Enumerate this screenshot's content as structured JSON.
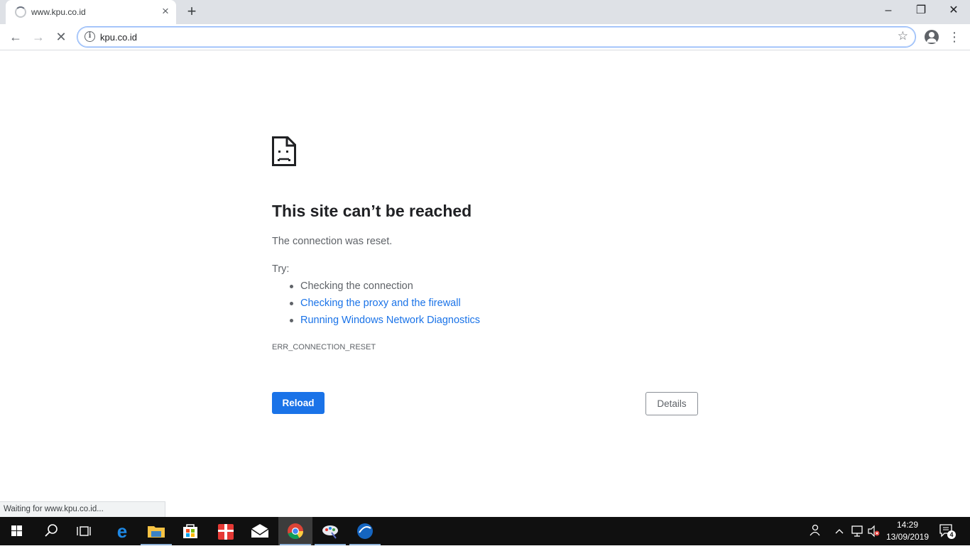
{
  "browser": {
    "tab_title": "www.kpu.co.id",
    "tab_close": "×",
    "new_tab": "+",
    "window_buttons": {
      "minimize": "–",
      "restore": "❐",
      "close": "✕"
    }
  },
  "toolbar": {
    "back": "←",
    "forward": "→",
    "stop": "✕",
    "address_value": "kpu.co.id",
    "star": "☆",
    "menu": "⋮"
  },
  "error_page": {
    "heading": "This site can’t be reached",
    "message": "The connection was reset.",
    "try_label": "Try:",
    "suggestions": [
      {
        "text": "Checking the connection",
        "link": false
      },
      {
        "text": "Checking the proxy and the firewall",
        "link": true
      },
      {
        "text": "Running Windows Network Diagnostics",
        "link": true
      }
    ],
    "error_code": "ERR_CONNECTION_RESET",
    "reload_label": "Reload",
    "details_label": "Details"
  },
  "status_bar": {
    "text": "Waiting for www.kpu.co.id..."
  },
  "taskbar": {
    "apps": [
      "start-icon",
      "search-icon",
      "task-view-icon",
      "edge-icon",
      "file-explorer-icon",
      "store-icon",
      "gift-icon",
      "mail-icon",
      "chrome-icon",
      "paint-icon",
      "app-icon"
    ],
    "active_app": "chrome-icon",
    "clock_time": "14:29",
    "clock_date": "13/09/2019",
    "notification_count": "4"
  },
  "colors": {
    "accent": "#1a73e8",
    "taskbar": "#101010",
    "tabstrip": "#dee1e6"
  }
}
